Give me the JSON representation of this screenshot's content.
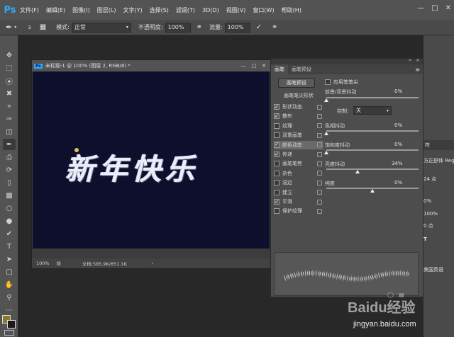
{
  "app": {
    "logo": "Ps"
  },
  "menubar": {
    "items": [
      "文件(F)",
      "编辑(E)",
      "图像(I)",
      "图层(L)",
      "文字(Y)",
      "选择(S)",
      "滤镜(T)",
      "3D(D)",
      "视图(V)",
      "窗口(W)",
      "帮助(H)"
    ]
  },
  "options": {
    "brush_size": "3",
    "mode_label": "模式:",
    "mode_value": "正常",
    "opacity_label": "不透明度:",
    "opacity_value": "100%",
    "flow_label": "流量:",
    "flow_value": "100%"
  },
  "document": {
    "title": "未标题-1 @ 100% (图层 2, RGB/8) *",
    "canvas_text": "新年快乐",
    "zoom": "100%",
    "doc_info": "文档:585.9K/851.1K"
  },
  "brush_panel": {
    "tabs": [
      "画笔",
      "画笔预设"
    ],
    "preset_button": "画笔预设",
    "tip_shape_button": "画笔笔尖形状",
    "wet_edges_checkbox": "应用笔笔尖",
    "options": [
      {
        "label": "形状动态",
        "checked": true
      },
      {
        "label": "散布",
        "checked": true
      },
      {
        "label": "纹理",
        "checked": false
      },
      {
        "label": "双重画笔",
        "checked": false
      },
      {
        "label": "颜色动态",
        "checked": true
      },
      {
        "label": "传递",
        "checked": true
      },
      {
        "label": "画笔笔势",
        "checked": false
      },
      {
        "label": "杂色",
        "checked": false
      },
      {
        "label": "湿边",
        "checked": false
      },
      {
        "label": "建立",
        "checked": false
      },
      {
        "label": "平滑",
        "checked": true
      },
      {
        "label": "保护纹理",
        "checked": false
      }
    ],
    "jitters": [
      {
        "label": "前景/背景抖动",
        "value": "0%",
        "level": 0
      },
      {
        "label": "色相抖动",
        "value": "0%",
        "level": 0
      },
      {
        "label": "饱和度抖动",
        "value": "0%",
        "level": 0
      },
      {
        "label": "亮度抖动",
        "value": "34%",
        "level": 34
      },
      {
        "label": "纯度",
        "value": "0%",
        "level": 50
      }
    ],
    "control_label": "控制:",
    "control_value": "关"
  },
  "right_dock": {
    "tab": "符",
    "items": [
      "方正舒体 Reg.",
      "24 点",
      "0%",
      "100%",
      "0 点",
      "T",
      "美国英语"
    ]
  },
  "watermark": {
    "brand": "Baidu经验",
    "url": "jingyan.baidu.com"
  },
  "colors": {
    "canvas": "#0e0f2c",
    "accent": "#31a8ff",
    "text": "#ebeefa"
  }
}
